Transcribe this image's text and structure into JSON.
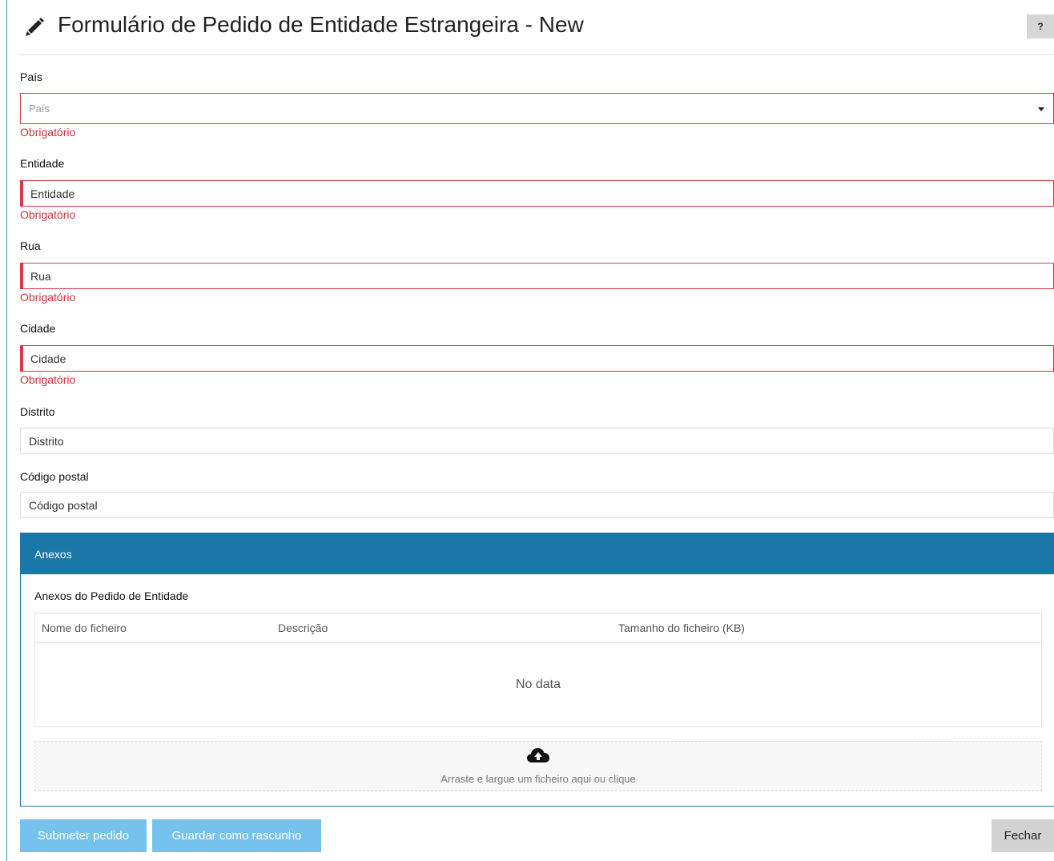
{
  "header": {
    "title": "Formulário de Pedido de Entidade Estrangeira - New",
    "help_label": "?"
  },
  "form": {
    "pais": {
      "label": "País",
      "placeholder": "País",
      "error": "Obrigatório"
    },
    "entidade": {
      "label": "Entidade",
      "placeholder": "Entidade",
      "error": "Obrigatório"
    },
    "rua": {
      "label": "Rua",
      "placeholder": "Rua",
      "error": "Obrigatório"
    },
    "cidade": {
      "label": "Cidade",
      "placeholder": "Cidade",
      "error": "Obrigatório"
    },
    "distrito": {
      "label": "Distrito",
      "placeholder": "Distrito"
    },
    "codigo_postal": {
      "label": "Código postal",
      "placeholder": "Código postal"
    }
  },
  "attachments": {
    "panel_title": "Anexos",
    "section_title": "Anexos do Pedido de Entidade",
    "columns": [
      "Nome do ficheiro",
      "Descrição",
      "Tamanho do ficheiro (KB)"
    ],
    "empty_text": "No data",
    "dropzone_hint": "Arraste e largue um ficheiro aqui ou clique",
    "dropzone_icon": "cloud-upload-icon"
  },
  "actions": {
    "submit": "Submeter pedido",
    "draft": "Guardar como rascunho",
    "close": "Fechar"
  },
  "colors": {
    "accent": "#1a77a8",
    "error": "#d12f3a",
    "button": "#75c3ec",
    "close_button": "#d2d2d2"
  }
}
